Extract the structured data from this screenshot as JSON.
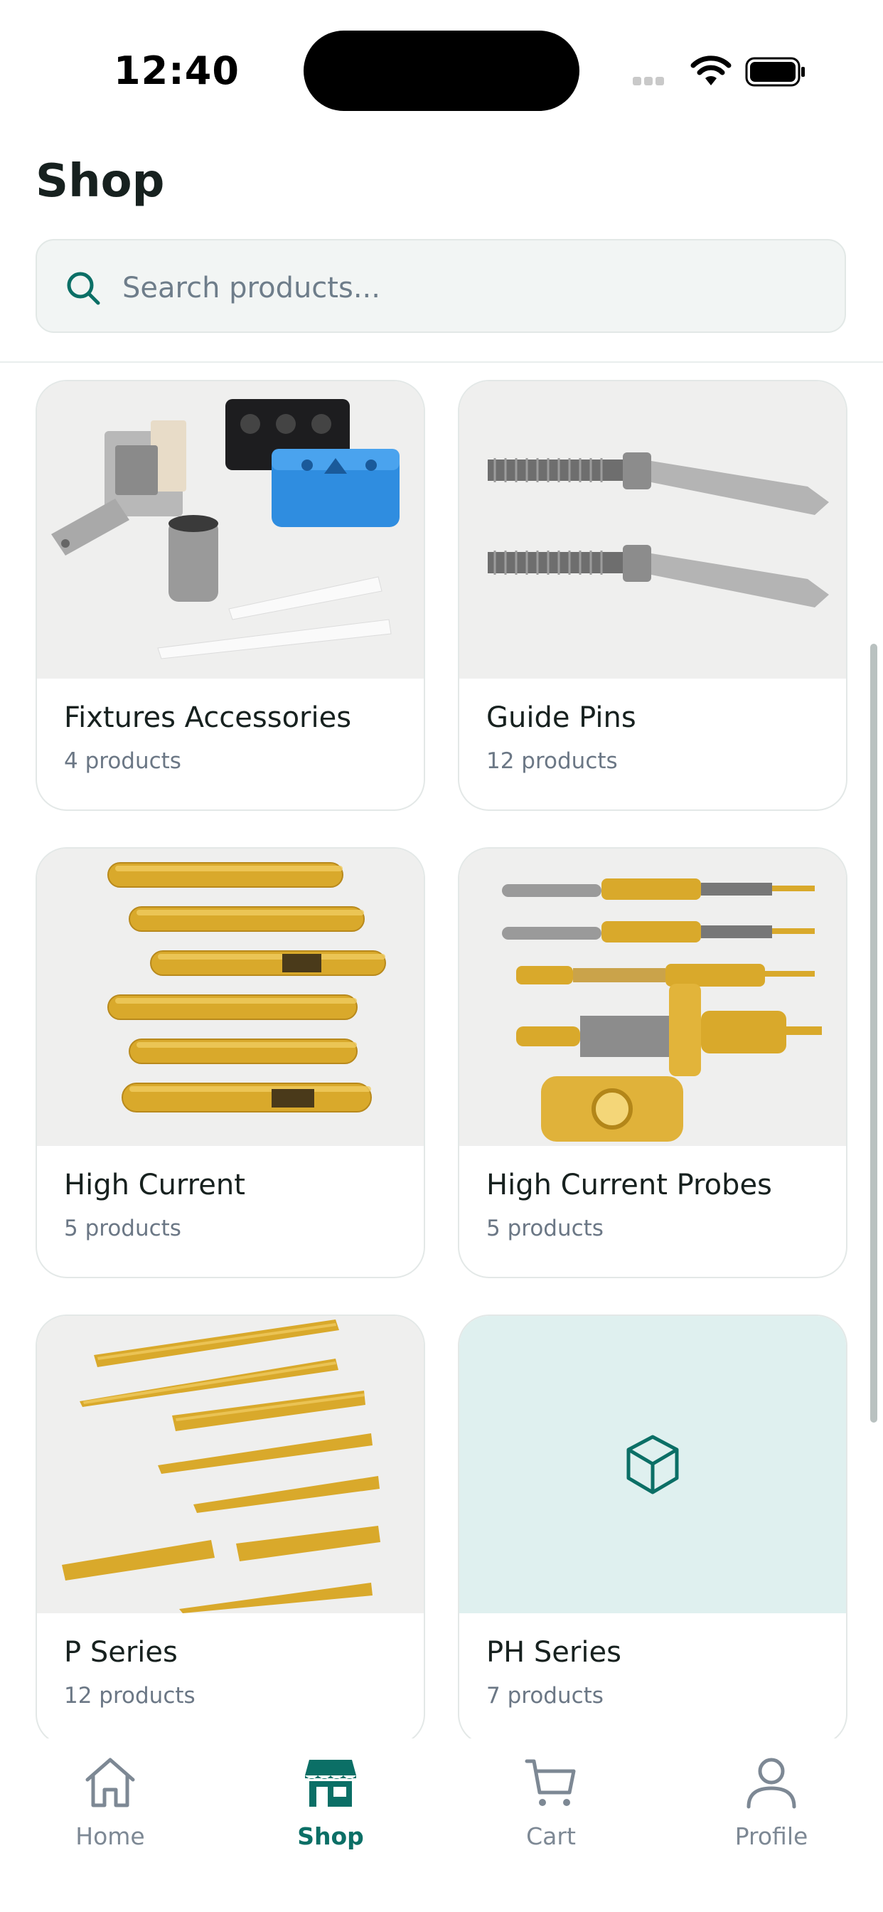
{
  "status_bar": {
    "time": "12:40"
  },
  "header": {
    "title": "Shop"
  },
  "search": {
    "placeholder": "Search products..."
  },
  "categories": [
    {
      "name": "Fixtures Accessories",
      "count": "4 products"
    },
    {
      "name": "Guide Pins",
      "count": "12 products"
    },
    {
      "name": "High Current",
      "count": "5 products"
    },
    {
      "name": "High Current Probes",
      "count": "5 products"
    },
    {
      "name": "P Series",
      "count": "12 products"
    },
    {
      "name": "PH Series",
      "count": "7 products"
    }
  ],
  "tab_bar": {
    "items": [
      {
        "label": "Home",
        "icon": "home-icon",
        "active": false
      },
      {
        "label": "Shop",
        "icon": "store-icon",
        "active": true
      },
      {
        "label": "Cart",
        "icon": "cart-icon",
        "active": false
      },
      {
        "label": "Profile",
        "icon": "profile-icon",
        "active": false
      }
    ]
  },
  "colors": {
    "accent": "#0b6f66",
    "inactive": "#7d8894",
    "placeholder_tile": "#dff0ef"
  }
}
